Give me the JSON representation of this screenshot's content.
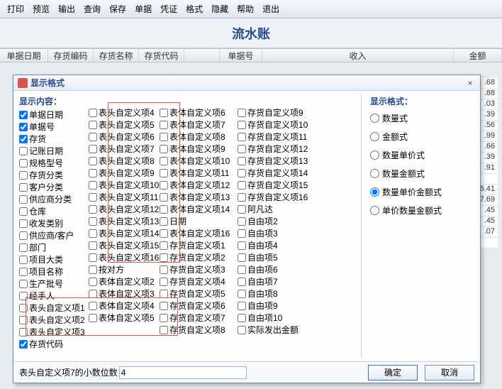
{
  "menu": [
    "打印",
    "预览",
    "输出",
    "查询",
    "保存",
    "单据",
    "凭证",
    "格式",
    "隐藏",
    "帮助",
    "退出"
  ],
  "page_title": "流水账",
  "grid_headers": {
    "c1": "单据日期",
    "c2": "存货编码",
    "c3": "存货名称",
    "c4": "存货代码",
    "c5": "单据号",
    "c6": "收入",
    "c7": "金额"
  },
  "grid_amounts": [
    ".68",
    ".88",
    ".03",
    ".39",
    ".56",
    ".99",
    ".66",
    ".39",
    ".91",
    "",
    "6.41",
    "7.69",
    ".45",
    ".45",
    ".07",
    ""
  ],
  "dialog": {
    "title": "显示格式",
    "section_left": "显示内容：",
    "section_right": "显示格式：",
    "close": "×",
    "footer_label": "表头自定义项7的小数位数",
    "footer_value": "4",
    "ok": "确定",
    "cancel": "取消"
  },
  "col1": [
    {
      "l": "单据日期",
      "c": true
    },
    {
      "l": "单据号",
      "c": true
    },
    {
      "l": "存货",
      "c": true
    },
    {
      "l": "记账日期"
    },
    {
      "l": "规格型号"
    },
    {
      "l": "存货分类"
    },
    {
      "l": "客户分类"
    },
    {
      "l": "供应商分类"
    },
    {
      "l": "仓库"
    },
    {
      "l": "收发类别"
    },
    {
      "l": "供应商/客户"
    },
    {
      "l": "部门"
    },
    {
      "l": "项目大类"
    },
    {
      "l": "项目名称"
    },
    {
      "l": "生产批号"
    },
    {
      "l": "经手人"
    },
    {
      "l": "表头自定义项1"
    },
    {
      "l": "表头自定义项2"
    },
    {
      "l": "表头自定义项3"
    },
    {
      "l": "存货代码",
      "c": true
    }
  ],
  "col2": [
    {
      "l": "表头自定义项4"
    },
    {
      "l": "表头自定义项5"
    },
    {
      "l": "表头自定义项6"
    },
    {
      "l": "表头自定义项7"
    },
    {
      "l": "表头自定义项8"
    },
    {
      "l": "表头自定义项9"
    },
    {
      "l": "表头自定义项10"
    },
    {
      "l": "表头自定义项11"
    },
    {
      "l": "表头自定义项12"
    },
    {
      "l": "表头自定义项13"
    },
    {
      "l": "表头自定义项14"
    },
    {
      "l": "表头自定义项15"
    },
    {
      "l": "表头自定义项16"
    },
    {
      "l": "按对方"
    },
    {
      "l": "表体自定义项2"
    },
    {
      "l": "表体自定义项3"
    },
    {
      "l": "表体自定义项4"
    },
    {
      "l": "表体自定义项5"
    }
  ],
  "col3": [
    {
      "l": "表体自定义项6"
    },
    {
      "l": "表体自定义项7"
    },
    {
      "l": "表体自定义项8"
    },
    {
      "l": "表体自定义项9"
    },
    {
      "l": "表体自定义项10"
    },
    {
      "l": "表体自定义项11"
    },
    {
      "l": "表体自定义项12"
    },
    {
      "l": "表体自定义项13"
    },
    {
      "l": "表体自定义项14"
    },
    {
      "l": "日期"
    },
    {
      "l": "表体自定义项16"
    },
    {
      "l": "存货自定义项1"
    },
    {
      "l": "存货自定义项2"
    },
    {
      "l": "存货自定义项3"
    },
    {
      "l": "存货自定义项4"
    },
    {
      "l": "存货自定义项5"
    },
    {
      "l": "存货自定义项6"
    },
    {
      "l": "存货自定义项7"
    },
    {
      "l": "存货自定义项8"
    }
  ],
  "col4": [
    {
      "l": "存货自定义项9"
    },
    {
      "l": "存货自定义项10"
    },
    {
      "l": "存货自定义项11"
    },
    {
      "l": "存货自定义项12"
    },
    {
      "l": "存货自定义项13"
    },
    {
      "l": "存货自定义项14"
    },
    {
      "l": "存货自定义项15"
    },
    {
      "l": "存货自定义项16"
    },
    {
      "l": "阿凡达"
    },
    {
      "l": "自由项2"
    },
    {
      "l": "自由项3"
    },
    {
      "l": "自由项4"
    },
    {
      "l": "自由项5"
    },
    {
      "l": "自由项6"
    },
    {
      "l": "自由项7"
    },
    {
      "l": "自由项8"
    },
    {
      "l": "自由项9"
    },
    {
      "l": "自由项10"
    },
    {
      "l": "实际发出金额"
    }
  ],
  "radios": [
    {
      "l": "数量式"
    },
    {
      "l": "金额式"
    },
    {
      "l": "数量单价式"
    },
    {
      "l": "数量金额式"
    },
    {
      "l": "数量单价金额式",
      "c": true
    },
    {
      "l": "单价数量金额式"
    }
  ]
}
